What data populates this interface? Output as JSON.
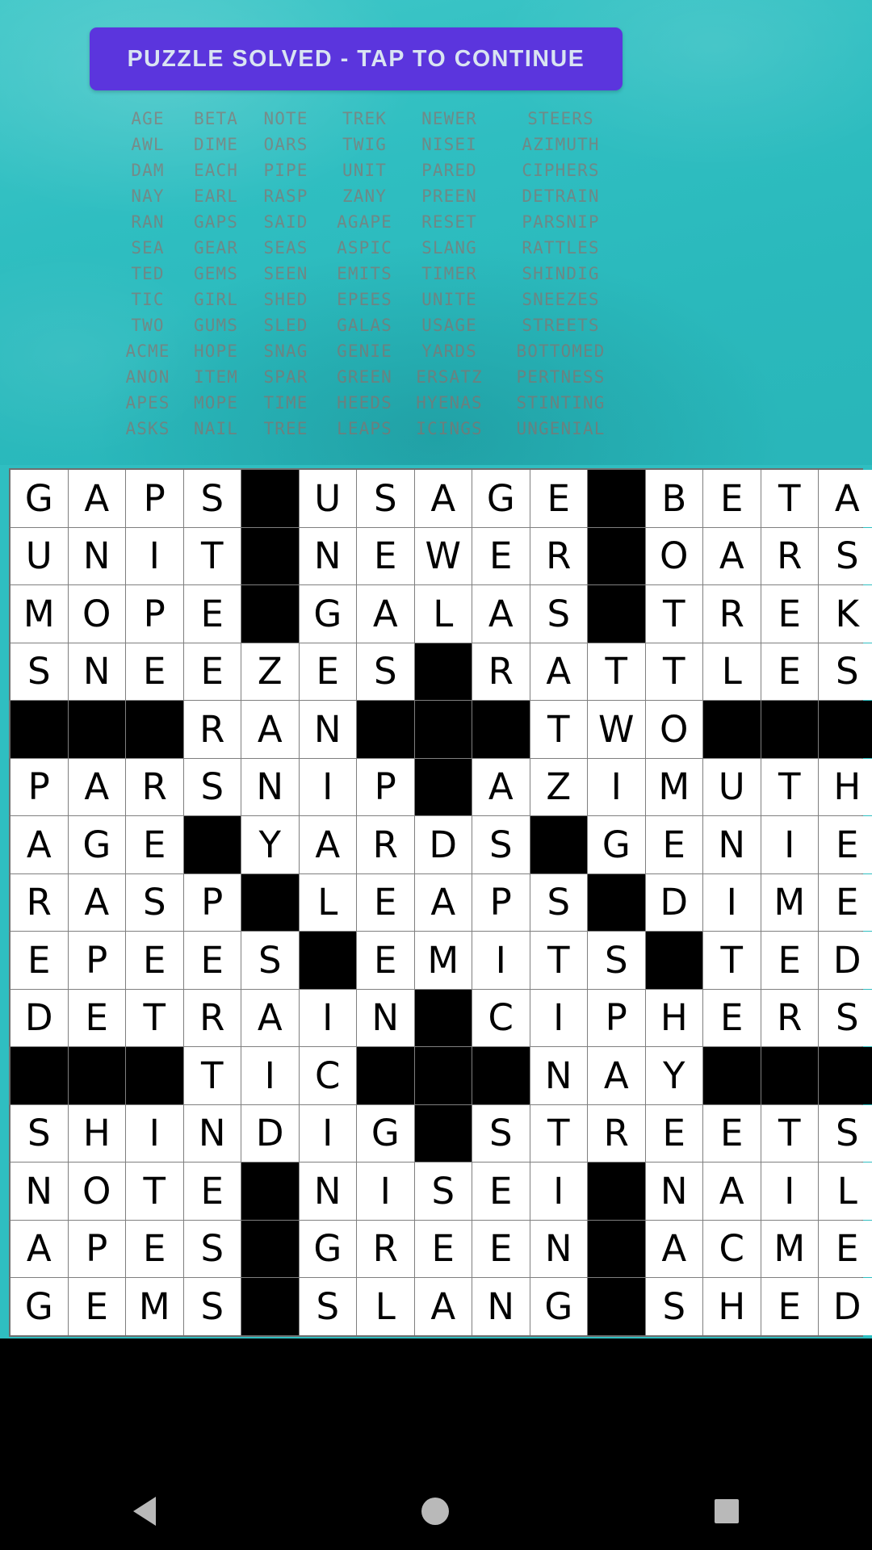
{
  "banner": {
    "label": "PUZZLE SOLVED - TAP TO CONTINUE",
    "bg_color": "#5b35dd",
    "text_color": "#d9e4f2"
  },
  "background": {
    "color": "#2fbec1"
  },
  "word_list": {
    "text_color": "#96696464",
    "rows": [
      [
        "AGE",
        "BETA",
        "NOTE",
        "TREK",
        "NEWER",
        "STEERS"
      ],
      [
        "AWL",
        "DIME",
        "OARS",
        "TWIG",
        "NISEI",
        "AZIMUTH"
      ],
      [
        "DAM",
        "EACH",
        "PIPE",
        "UNIT",
        "PARED",
        "CIPHERS"
      ],
      [
        "NAY",
        "EARL",
        "RASP",
        "ZANY",
        "PREEN",
        "DETRAIN"
      ],
      [
        "RAN",
        "GAPS",
        "SAID",
        "AGAPE",
        "RESET",
        "PARSNIP"
      ],
      [
        "SEA",
        "GEAR",
        "SEAS",
        "ASPIC",
        "SLANG",
        "RATTLES"
      ],
      [
        "TED",
        "GEMS",
        "SEEN",
        "EMITS",
        "TIMER",
        "SHINDIG"
      ],
      [
        "TIC",
        "GIRL",
        "SHED",
        "EPEES",
        "UNITE",
        "SNEEZES"
      ],
      [
        "TWO",
        "GUMS",
        "SLED",
        "GALAS",
        "USAGE",
        "STREETS"
      ],
      [
        "ACME",
        "HOPE",
        "SNAG",
        "GENIE",
        "YARDS",
        "BOTTOMED"
      ],
      [
        "ANON",
        "ITEM",
        "SPAR",
        "GREEN",
        "ERSATZ",
        "PERTNESS"
      ],
      [
        "APES",
        "MOPE",
        "TIME",
        "HEEDS",
        "HYENAS",
        "STINTING"
      ],
      [
        "ASKS",
        "NAIL",
        "TREE",
        "LEAPS",
        "ICINGS",
        "UNGENIAL"
      ]
    ]
  },
  "crossword": {
    "columns": 15,
    "rows": 15,
    "block_color": "#000000",
    "cell_color": "#ffffff",
    "grid": [
      [
        "G",
        "A",
        "P",
        "S",
        "#",
        "U",
        "S",
        "A",
        "G",
        "E",
        "#",
        "B",
        "E",
        "T",
        "A"
      ],
      [
        "U",
        "N",
        "I",
        "T",
        "#",
        "N",
        "E",
        "W",
        "E",
        "R",
        "#",
        "O",
        "A",
        "R",
        "S"
      ],
      [
        "M",
        "O",
        "P",
        "E",
        "#",
        "G",
        "A",
        "L",
        "A",
        "S",
        "#",
        "T",
        "R",
        "E",
        "K"
      ],
      [
        "S",
        "N",
        "E",
        "E",
        "Z",
        "E",
        "S",
        "#",
        "R",
        "A",
        "T",
        "T",
        "L",
        "E",
        "S"
      ],
      [
        "#",
        "#",
        "#",
        "R",
        "A",
        "N",
        "#",
        "#",
        "#",
        "T",
        "W",
        "O",
        "#",
        "#",
        "#"
      ],
      [
        "P",
        "A",
        "R",
        "S",
        "N",
        "I",
        "P",
        "#",
        "A",
        "Z",
        "I",
        "M",
        "U",
        "T",
        "H"
      ],
      [
        "A",
        "G",
        "E",
        "#",
        "Y",
        "A",
        "R",
        "D",
        "S",
        "#",
        "G",
        "E",
        "N",
        "I",
        "E"
      ],
      [
        "R",
        "A",
        "S",
        "P",
        "#",
        "L",
        "E",
        "A",
        "P",
        "S",
        "#",
        "D",
        "I",
        "M",
        "E"
      ],
      [
        "E",
        "P",
        "E",
        "E",
        "S",
        "#",
        "E",
        "M",
        "I",
        "T",
        "S",
        "#",
        "T",
        "E",
        "D"
      ],
      [
        "D",
        "E",
        "T",
        "R",
        "A",
        "I",
        "N",
        "#",
        "C",
        "I",
        "P",
        "H",
        "E",
        "R",
        "S"
      ],
      [
        "#",
        "#",
        "#",
        "T",
        "I",
        "C",
        "#",
        "#",
        "#",
        "N",
        "A",
        "Y",
        "#",
        "#",
        "#"
      ],
      [
        "S",
        "H",
        "I",
        "N",
        "D",
        "I",
        "G",
        "#",
        "S",
        "T",
        "R",
        "E",
        "E",
        "T",
        "S"
      ],
      [
        "N",
        "O",
        "T",
        "E",
        "#",
        "N",
        "I",
        "S",
        "E",
        "I",
        "#",
        "N",
        "A",
        "I",
        "L"
      ],
      [
        "A",
        "P",
        "E",
        "S",
        "#",
        "G",
        "R",
        "E",
        "E",
        "N",
        "#",
        "A",
        "C",
        "M",
        "E"
      ],
      [
        "G",
        "E",
        "M",
        "S",
        "#",
        "S",
        "L",
        "A",
        "N",
        "G",
        "#",
        "S",
        "H",
        "E",
        "D"
      ]
    ]
  },
  "navbar": {
    "back_label": "back-triangle",
    "home_label": "home-circle",
    "recents_label": "recents-square"
  }
}
